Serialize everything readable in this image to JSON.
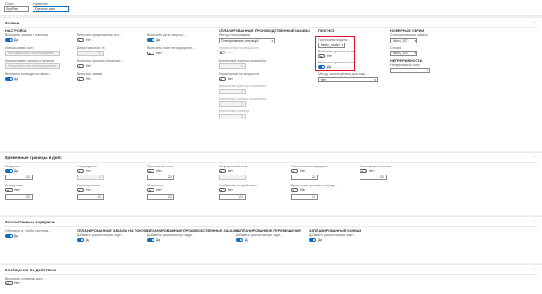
{
  "header": {
    "plan_label": "План",
    "plan_value": "SysPlan",
    "name_label": "Название",
    "name_value": "Dynamic plan"
  },
  "sections": {
    "general": "Разное",
    "time_limits": "Временные границы в днях",
    "delays": "Рассчитанные задержки",
    "messages": "Сообщения по действию"
  },
  "setup": {
    "heading": "НАСТРОЙКА",
    "include_stock_label": "Включить запасы в наличии",
    "include_stock": "Да",
    "use_receipts_label": "Использовать кол...",
    "use_receipts_placeholder": "Неправильное использование...",
    "min_stock_label": "Использовать запасы в наличии",
    "min_stock_placeholder": "Нисколько или только хранение",
    "include_returns_label": "Включить проводки по запас...",
    "include_returns": "Да",
    "forecast_reduction_label": "Включить предложение по с...",
    "forecast_reduction": "Нет",
    "delay_pct_label": "Допустимость в %",
    "delay_pct": "0",
    "include_requests_label": "Включить запросы предложе...",
    "include_requests": "Нет",
    "include_quotes_label": "Включить заявки",
    "include_quotes": "Нет",
    "include_requisition_label": "Включить даты запросы ...",
    "include_requisition": "Да",
    "include_intercompany_label": "Включить план нетрадиционн...",
    "include_intercompany": "Нет"
  },
  "planned_production": {
    "heading": "СПЛАНИРОВАННЫЕ ПРОИЗВОДСТВЕННЫЕ ЗАКАЗЫ",
    "method_label": "Метод планирования",
    "method_value": "Планирование операций",
    "capacity_label": "Ограничение по мощности",
    "capacity": "Нет",
    "capacity_window_label": "Временные границы мощности ...",
    "capacity_window": "0",
    "material_label": "Ограничение по мощности",
    "material": "Нет",
    "backward_label": "Временные границы ограничен...",
    "backward": "0",
    "horizon_label": "Временная граница продления...",
    "horizon": "0",
    "horizon2_label": "Временные границы",
    "horizon2": "0"
  },
  "forecast": {
    "heading": "ПРОГНОЗ",
    "model_label": "Прогнозная модель",
    "model_value": "Basic_model",
    "include_supply_label": "Включить прогноз поставок",
    "include_supply": "Нет",
    "include_demand_label": "Включить прогноз спроса",
    "include_demand": "Да",
    "method_label": "Метод, используемый для сокр...",
    "method_value": "Нет"
  },
  "series": {
    "heading": "НОМЕРНЫЕ СЕРИИ",
    "planned_orders_label": "Спланированные заказы",
    "planned_orders": "Ward_207",
    "session_label": "Сессия",
    "session": "Ward_206"
  },
  "continuity": {
    "heading": "НЕПРЕРЫВНОСТЬ",
    "plan_label": "Непрерывный план",
    "plan_value": ""
  },
  "time_limits": {
    "cols": [
      {
        "label": "Покрытие",
        "toggle": "Да",
        "value": "21"
      },
      {
        "label": "Утверждение",
        "toggle": "Нет",
        "value": "0"
      },
      {
        "label": "Прогнозный план",
        "toggle": "Нет",
        "value": "21"
      },
      {
        "label": "Непрерывный план",
        "toggle": "Нет",
        "value": ""
      },
      {
        "label": "Рассчитанные задержки",
        "toggle": "Нет",
        "value": "21"
      },
      {
        "label": "Последовательность",
        "toggle": "Нет",
        "value": "21"
      }
    ],
    "cols2": [
      {
        "label": "Блокировка",
        "toggle": "Нет",
        "value": "21"
      },
      {
        "label": "Приоступление",
        "toggle": "Нет",
        "value": "21"
      },
      {
        "label": "Мощность",
        "toggle": "Нет",
        "value": "21"
      },
      {
        "label": "Сообщение по действию",
        "toggle": "Нет",
        "value": "21"
      },
      {
        "label": "Временная граница утвержд...",
        "toggle": "Нет",
        "value": "21"
      }
    ]
  },
  "delays": {
    "add_label": "Обеспечить, чтобы системы...",
    "add": "Да",
    "cols": [
      {
        "heading": "СПЛАНИРОВАННЫЕ ЗАКАЗЫ НА ПОКУПКУ",
        "label": "Добавить рассчитанную заде...",
        "toggle": "Да"
      },
      {
        "heading": "СПЛАНИРОВАННЫЕ ПРОИЗВОДСТВЕННЫЕ ЗАКАЗЫ",
        "label": "Добавить рассчитанную заде...",
        "toggle": "Да"
      },
      {
        "heading": "ЗАПЛАНИРОВАННОЕ ПЕРЕМЕЩЕНИЕ",
        "label": "Добавить рассчитанную заде...",
        "toggle": "Да"
      },
      {
        "heading": "ЗАПЛАНИРОВАННЫЙ КАНБАН",
        "label": "Добавить рассчитанную заде...",
        "toggle": "Да"
      }
    ]
  },
  "messages": {
    "label": "Включить основную дату ...",
    "toggle": "Нет"
  },
  "colors": {
    "accent": "#0f6cbd",
    "highlight": "#e81123"
  }
}
